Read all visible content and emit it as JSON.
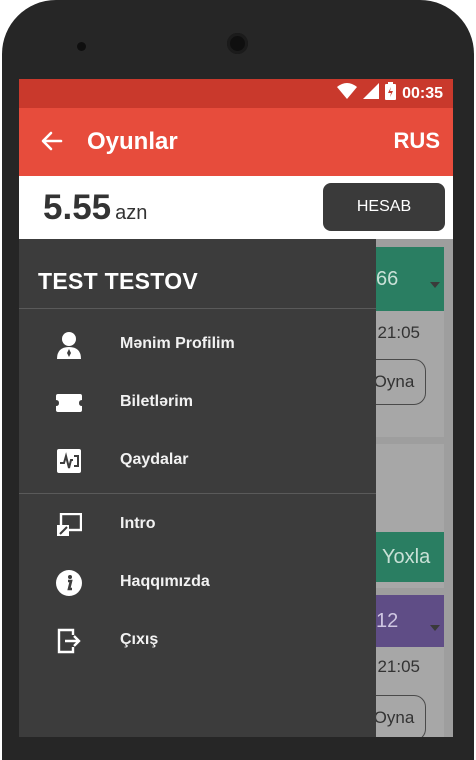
{
  "status_bar": {
    "time": "00:35"
  },
  "app_bar": {
    "title": "Oyunlar",
    "language": "RUS"
  },
  "balance": {
    "value": "5.55",
    "unit": "azn",
    "button": "HESAB"
  },
  "background_cards": [
    {
      "chip": "66",
      "time": "t 21:05",
      "action": "Oyna",
      "chip_color": "#2a7e62"
    },
    {
      "action": "Yoxla",
      "chip_color": "#2a7e62"
    },
    {
      "chip": "12",
      "time": "t 21:05",
      "action": "Oyna",
      "chip_color": "#5f4d86"
    }
  ],
  "drawer": {
    "user_name": "TEST TESTOV",
    "items": [
      {
        "label": "Mənim Profilim",
        "icon": "user-icon"
      },
      {
        "label": "Biletlərim",
        "icon": "ticket-icon"
      },
      {
        "label": "Qaydalar",
        "icon": "rules-icon"
      },
      {
        "label": "Intro",
        "icon": "intro-icon"
      },
      {
        "label": "Haqqımızda",
        "icon": "info-icon"
      },
      {
        "label": "Çıxış",
        "icon": "exit-icon"
      }
    ]
  },
  "colors": {
    "status_bar": "#c9392c",
    "app_bar": "#e74c3c",
    "drawer": "#3c3c3c",
    "button_dark": "#3a3a3a"
  }
}
